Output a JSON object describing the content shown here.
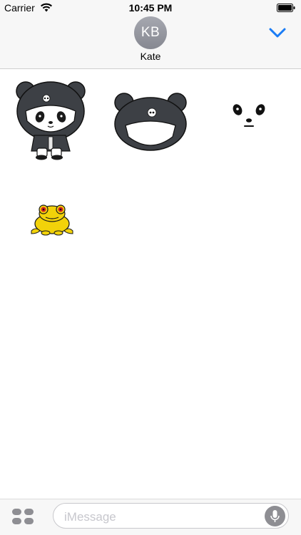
{
  "status_bar": {
    "carrier": "Carrier",
    "time": "10:45 PM",
    "wifi_icon": "wifi-icon",
    "battery_icon": "battery-icon"
  },
  "conversation": {
    "avatar_initials": "KB",
    "contact_name": "Kate",
    "collapse_icon": "chevron-down-icon",
    "accent_color": "#1a7cf5"
  },
  "stickers": [
    {
      "name": "panda-hoodie-sitting"
    },
    {
      "name": "panda-hood"
    },
    {
      "name": "panda-face"
    },
    {
      "name": "yellow-frog"
    }
  ],
  "input_bar": {
    "apps_icon": "apps-grid-icon",
    "placeholder": "iMessage",
    "mic_icon": "microphone-icon"
  }
}
